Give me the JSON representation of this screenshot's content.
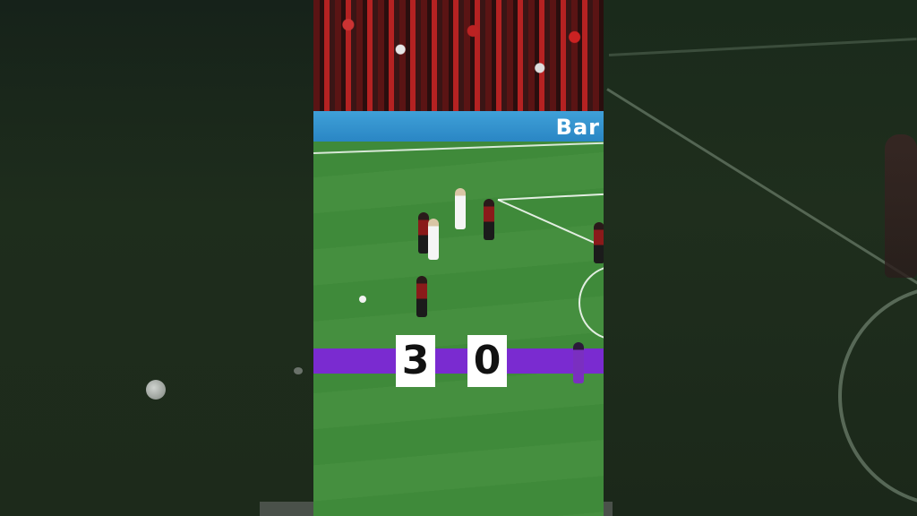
{
  "board": {
    "text": "Bar"
  },
  "score": {
    "home": "3",
    "away": "0"
  },
  "colors": {
    "score_band": "#7a2bd0",
    "pitch": "#428c3c",
    "board": "#3595d0"
  }
}
